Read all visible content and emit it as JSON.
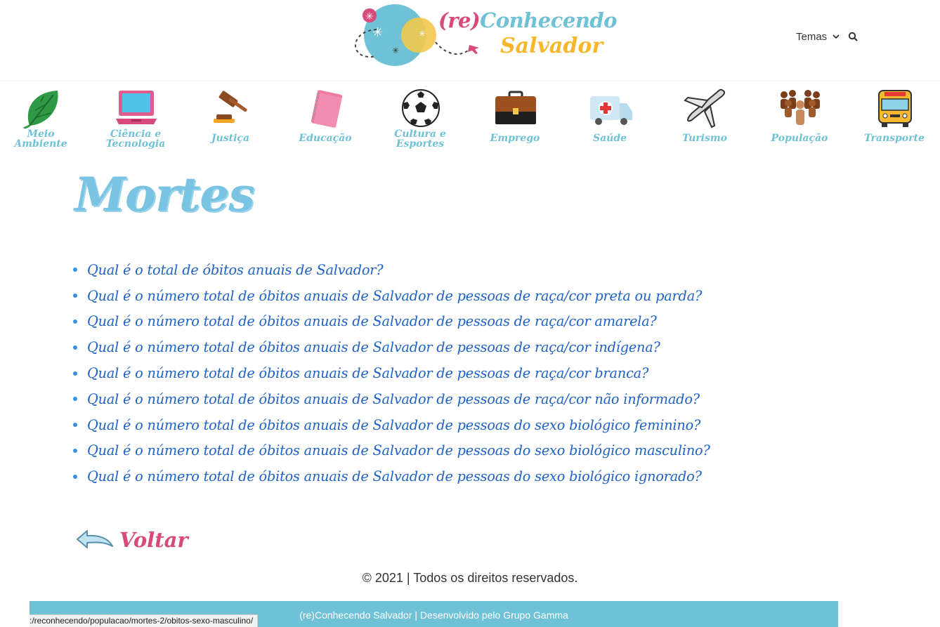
{
  "header": {
    "logo": {
      "prefix": "(re)",
      "word1": "Conhecendo",
      "word2": "Salvador"
    },
    "menu_label": "Temas",
    "search_icon": "search-icon"
  },
  "categories": [
    {
      "label_lines": [
        "Meio",
        "Ambiente"
      ],
      "icon": "leaf-icon"
    },
    {
      "label_lines": [
        "Ciência e",
        "Tecnologia"
      ],
      "icon": "laptop-icon"
    },
    {
      "label_lines": [
        "Justiça"
      ],
      "icon": "gavel-icon"
    },
    {
      "label_lines": [
        "Educação"
      ],
      "icon": "notebook-icon"
    },
    {
      "label_lines": [
        "Cultura e",
        "Esportes"
      ],
      "icon": "soccer-ball-icon"
    },
    {
      "label_lines": [
        "Emprego"
      ],
      "icon": "briefcase-icon"
    },
    {
      "label_lines": [
        "Saúde"
      ],
      "icon": "ambulance-icon"
    },
    {
      "label_lines": [
        "Turismo"
      ],
      "icon": "airplane-icon"
    },
    {
      "label_lines": [
        "População"
      ],
      "icon": "people-icon"
    },
    {
      "label_lines": [
        "Transporte"
      ],
      "icon": "bus-icon"
    }
  ],
  "page": {
    "title": "Mortes",
    "questions": [
      "Qual é o total de óbitos anuais de Salvador?",
      "Qual é o número total de óbitos anuais de Salvador de pessoas de raça/cor preta ou parda?",
      "Qual é o número total de óbitos anuais de Salvador de pessoas de raça/cor amarela?",
      "Qual é o número total de óbitos anuais de Salvador de pessoas de raça/cor indígena?",
      "Qual é o número total de óbitos anuais de Salvador de pessoas de raça/cor branca?",
      "Qual é o número total de óbitos anuais de Salvador de pessoas de raça/cor não informado?",
      "Qual é o número total de óbitos anuais de Salvador de pessoas do sexo biológico feminino?",
      "Qual é o número total de óbitos anuais de Salvador de pessoas do sexo biológico masculino?",
      "Qual é o número total de óbitos anuais de Salvador de pessoas do sexo biológico ignorado?"
    ],
    "back_label": "Voltar"
  },
  "footer": {
    "copyright": "© 2021 | Todos os direitos reservados.",
    "credit": "(re)Conhecendo Salvador | Desenvolvido pelo Grupo Gamma"
  },
  "status_bar_url": ":/reconhecendo/populacao/mortes-2/obitos-sexo-masculino/",
  "colors": {
    "brand_teal": "#6fc1d6",
    "brand_pink": "#d84a7c",
    "brand_yellow": "#f6b72d",
    "link_blue": "#1e62c8",
    "title_blue": "#79c3e3"
  }
}
